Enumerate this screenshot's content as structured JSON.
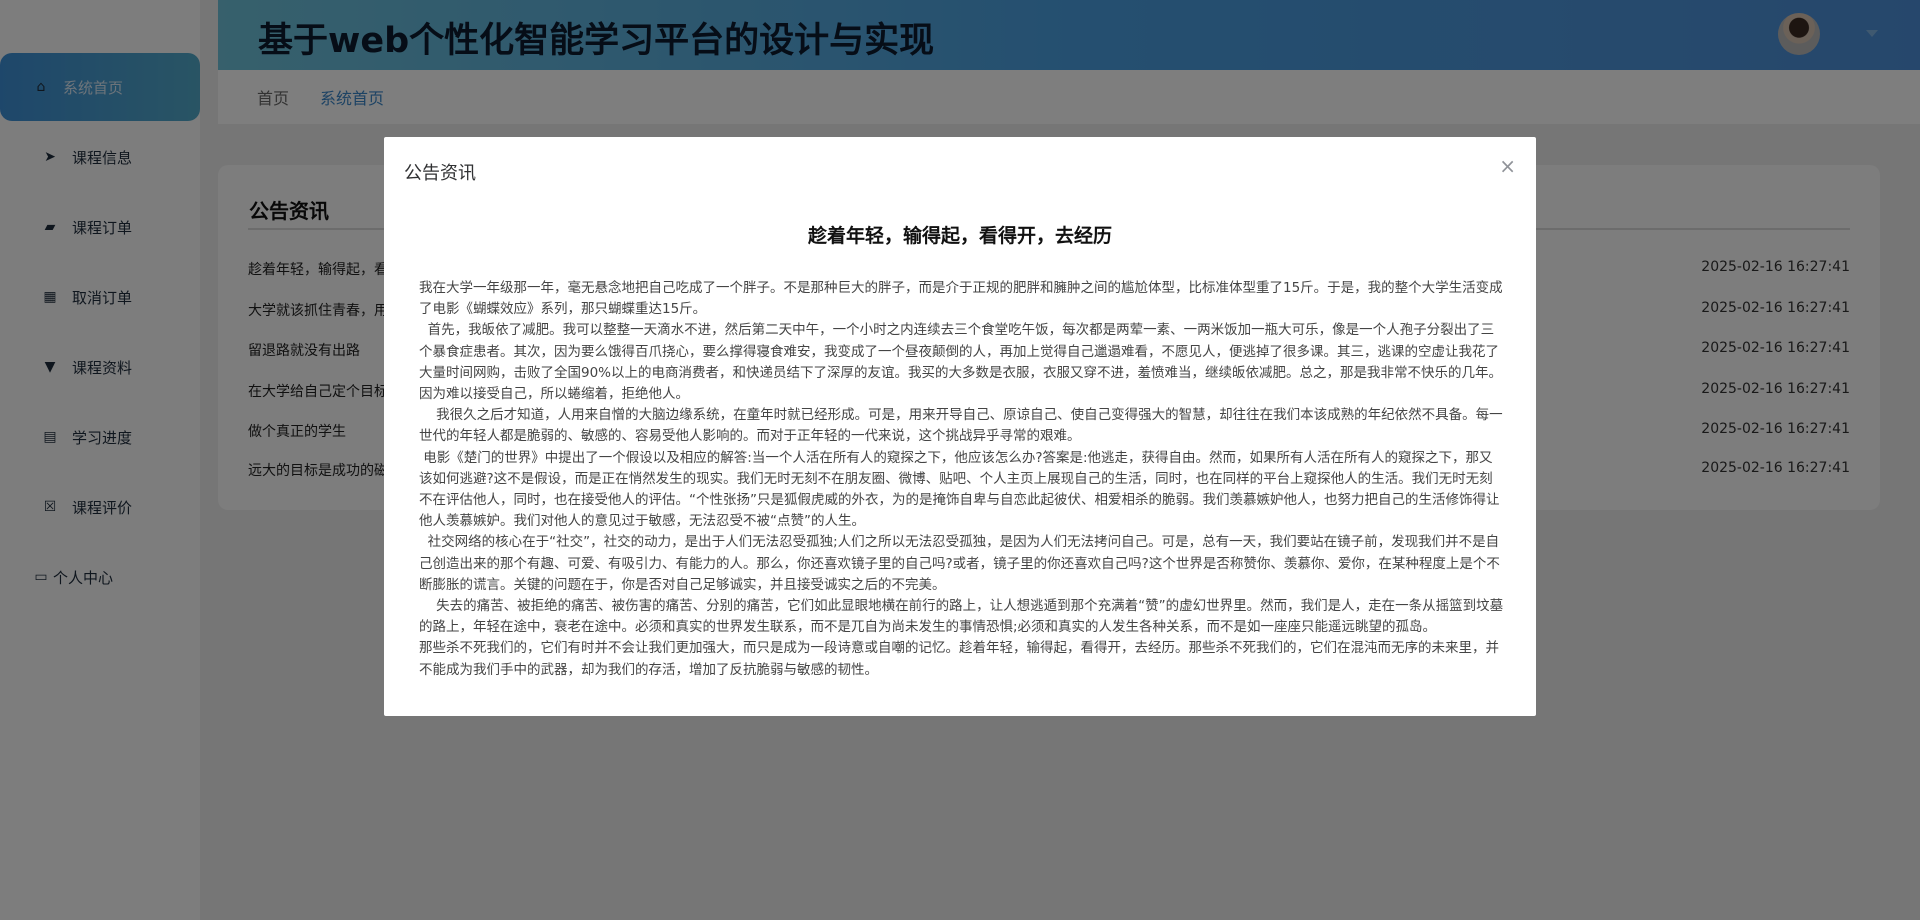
{
  "header": {
    "title": "基于web个性化智能学习平台的设计与实现"
  },
  "sidebar": {
    "items": [
      {
        "label": "系统首页",
        "icon": "home-icon"
      },
      {
        "label": "课程信息",
        "icon": "paper-plane-icon"
      },
      {
        "label": "课程订单",
        "icon": "wallet-icon"
      },
      {
        "label": "取消订单",
        "icon": "grid-icon"
      },
      {
        "label": "课程资料",
        "icon": "pin-icon"
      },
      {
        "label": "学习进度",
        "icon": "clipboard-icon"
      },
      {
        "label": "课程评价",
        "icon": "clipboard-x-icon"
      },
      {
        "label": "个人中心",
        "icon": "card-icon"
      }
    ]
  },
  "breadcrumb": [
    "首页",
    "系统首页"
  ],
  "notices": {
    "title": "公告资讯",
    "items": [
      {
        "title": "趁着年轻，输得起，看",
        "date": "2025-02-16 16:27:41"
      },
      {
        "title": "大学就该抓住青春，用",
        "date": "2025-02-16 16:27:41"
      },
      {
        "title": "留退路就没有出路",
        "date": "2025-02-16 16:27:41"
      },
      {
        "title": "在大学给自己定个目标",
        "date": "2025-02-16 16:27:41"
      },
      {
        "title": "做个真正的学生",
        "date": "2025-02-16 16:27:41"
      },
      {
        "title": "远大的目标是成功的磁",
        "date": "2025-02-16 16:27:41"
      }
    ]
  },
  "dialog": {
    "title": "公告资讯",
    "close": "×",
    "article_title": "趁着年轻，输得起，看得开，去经历",
    "paragraphs": [
      "我在大学一年级那一年，毫无悬念地把自己吃成了一个胖子。不是那种巨大的胖子，而是介于正规的肥胖和臃肿之间的尴尬体型，比标准体型重了15斤。于是，我的整个大学生活变成了电影《蝴蝶效应》系列，那只蝴蝶重达15斤。",
      "  首先，我皈依了减肥。我可以整整一天滴水不进，然后第二天中午，一个小时之内连续去三个食堂吃午饭，每次都是两荤一素、一两米饭加一瓶大可乐，像是一个人孢子分裂出了三个暴食症患者。其次，因为要么饿得百爪挠心，要么撑得寝食难安，我变成了一个昼夜颠倒的人，再加上觉得自己邋遢难看，不愿见人，便逃掉了很多课。其三，逃课的空虚让我花了大量时间网购，击败了全国90%以上的电商消费者，和快递员结下了深厚的友谊。我买的大多数是衣服，衣服又穿不进，羞愤难当，继续皈依减肥。总之，那是我非常不快乐的几年。因为难以接受自己，所以蜷缩着，拒绝他人。",
      "    我很久之后才知道，人用来自憎的大脑边缘系统，在童年时就已经形成。可是，用来开导自己、原谅自己、使自己变得强大的智慧，却往往在我们本该成熟的年纪依然不具备。每一世代的年轻人都是脆弱的、敏感的、容易受他人影响的。而对于正年轻的一代来说，这个挑战异乎寻常的艰难。",
      " 电影《楚门的世界》中提出了一个假设以及相应的解答:当一个人活在所有人的窥探之下，他应该怎么办?答案是:他逃走，获得自由。然而，如果所有人活在所有人的窥探之下，那又该如何逃避?这不是假设，而是正在悄然发生的现实。我们无时无刻不在朋友圈、微博、贴吧、个人主页上展现自己的生活，同时，也在同样的平台上窥探他人的生活。我们无时无刻不在评估他人，同时，也在接受他人的评估。“个性张扬”只是狐假虎威的外衣，为的是掩饰自卑与自恋此起彼伏、相爱相杀的脆弱。我们羡慕嫉妒他人，也努力把自己的生活修饰得让他人羡慕嫉妒。我们对他人的意见过于敏感，无法忍受不被“点赞”的人生。",
      "  社交网络的核心在于“社交”，社交的动力，是出于人们无法忍受孤独;人们之所以无法忍受孤独，是因为人们无法拷问自己。可是，总有一天，我们要站在镜子前，发现我们并不是自己创造出来的那个有趣、可爱、有吸引力、有能力的人。那么，你还喜欢镜子里的自己吗?或者，镜子里的你还喜欢自己吗?这个世界是否称赞你、羡慕你、爱你，在某种程度上是个不断膨胀的谎言。关键的问题在于，你是否对自己足够诚实，并且接受诚实之后的不完美。",
      "    失去的痛苦、被拒绝的痛苦、被伤害的痛苦、分别的痛苦，它们如此显眼地横在前行的路上，让人想逃遁到那个充满着“赞”的虚幻世界里。然而，我们是人，走在一条从摇篮到坟墓的路上，年轻在途中，衰老在途中。必须和真实的世界发生联系，而不是兀自为尚未发生的事情恐惧;必须和真实的人发生各种关系，而不是如一座座只能遥远眺望的孤岛。",
      "那些杀不死我们的，它们有时并不会让我们更加强大，而只是成为一段诗意或自嘲的记忆。趁着年轻，输得起，看得开，去经历。那些杀不死我们的，它们在混沌而无序的未来里，并不能成为我们手中的武器，却为我们的存活，增加了反抗脆弱与敏感的韧性。"
    ]
  }
}
